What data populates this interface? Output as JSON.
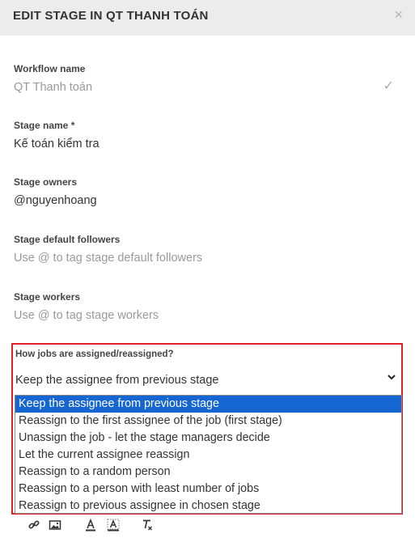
{
  "dialog": {
    "title": "EDIT STAGE IN QT THANH TOÁN",
    "close_icon": "×"
  },
  "fields": {
    "workflow_name": {
      "label": "Workflow name",
      "value": "QT Thanh toán"
    },
    "stage_name": {
      "label": "Stage name *",
      "value": "Kế toán kiểm tra"
    },
    "stage_owners": {
      "label": "Stage owners",
      "value": "@nguyenhoang"
    },
    "stage_default_followers": {
      "label": "Stage default followers",
      "placeholder": "Use @ to tag stage default followers"
    },
    "stage_workers": {
      "label": "Stage workers",
      "placeholder": "Use @ to tag stage workers"
    }
  },
  "assignment": {
    "label": "How jobs are assigned/reassigned?",
    "selected": "Keep the assignee from previous stage",
    "options": [
      "Keep the assignee from previous stage",
      "Reassign to the first assignee of the job (first stage)",
      "Unassign the job - let the stage managers decide",
      "Let the current assignee reassign",
      "Reassign to a random person",
      "Reassign to a person with least number of jobs",
      "Reassign to previous assignee in chosen stage"
    ]
  },
  "colors": {
    "header_bg": "#ececec",
    "highlight": "#e01e2a",
    "selected_option": "#1565d3"
  },
  "toolbar_icons": [
    "link-icon",
    "image-icon",
    "font-color-icon",
    "background-color-icon",
    "clear-format-icon"
  ]
}
